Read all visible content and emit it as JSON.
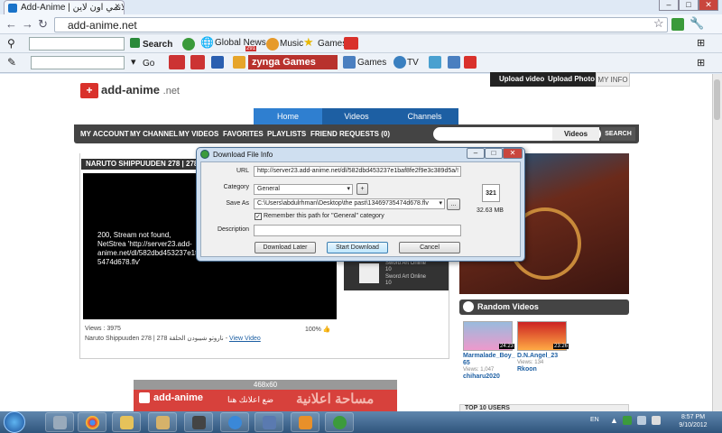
{
  "browser": {
    "tab_title": "Add-Anime | لانمي اون لاين",
    "url": "add-anime.net",
    "toolbar1": {
      "search_label": "Search",
      "global_news": "Global News",
      "news_badge": "291",
      "music": "Music",
      "games": "Games"
    },
    "toolbar2": {
      "go_label": "Go",
      "zynga": "zynga Games",
      "games": "Games",
      "tv": "TV"
    },
    "window_controls": [
      "–",
      "□",
      "✕"
    ]
  },
  "site": {
    "logo_text": "add-anime",
    "logo_tld": ".net",
    "upload_video": "Upload video",
    "upload_photo": "Upload Photo",
    "my_info": "MY INFO",
    "main_tabs": [
      "Home",
      "Videos",
      "Channels"
    ],
    "nav_items": [
      "MY ACCOUNT",
      "MY CHANNEL",
      "MY VIDEOS",
      "FAVORITES",
      "PLAYLISTS",
      "FRIEND REQUESTS (0)"
    ],
    "search_category": "Videos",
    "search_button": "SEARCH",
    "video_title": "NARUTO SHIPPUUDEN 278 | 278 ة",
    "player_message": "200, Stream not found, NetStrea 'http://server23.add-anime.net/dl/582dbd453237e1t 5474d678.flv'",
    "views": "Views : 3975",
    "rating_pct": "100%",
    "caption": "Naruto Shippuuden 278 | 278 ناروتو شيبودن الحلقة - ",
    "caption_link": "View Video",
    "related": [
      {
        "title": "Sword Art Online",
        "num": "10"
      },
      {
        "title": "Sword Art Online",
        "num": "10"
      }
    ],
    "random_videos_heading": "Random Videos",
    "random_videos": [
      {
        "title": "Marmalade_Boy_ 65",
        "views": "Views: 1,047",
        "user": "chiharu2020",
        "time": "24:23"
      },
      {
        "title": "D.N.Angel_23",
        "views": "Views: 134",
        "user": "Rkoon",
        "time": "23:26"
      }
    ],
    "top10": "TOP 10 USERS",
    "ad_header": "468x60",
    "ad_logo": "add-anime",
    "ad_tagline": "ضع اعلانك هنا",
    "ad_title": "مساحة اعلانية"
  },
  "dialog": {
    "title": "Download File Info",
    "url_label": "URL",
    "url_value": "http://server23.add-anime.net/dl/582dbd453237e1baf8fe2f9e3c389d5a/!",
    "category_label": "Category",
    "category_value": "General",
    "add_button": "+",
    "save_as_label": "Save As",
    "save_as_value": "C:\\Users\\abdulrhman\\Desktop\\the past\\13469735474d678.flv",
    "browse_button": "...",
    "remember_label": "Remember this path for \"General\" category",
    "description_label": "Description",
    "file_size": "32.63 MB",
    "file_icon_text": "321",
    "download_later": "Download Later",
    "start_download": "Start Download",
    "cancel": "Cancel"
  },
  "taskbar": {
    "language": "EN",
    "time": "8:57 PM",
    "date": "9/10/2012"
  }
}
